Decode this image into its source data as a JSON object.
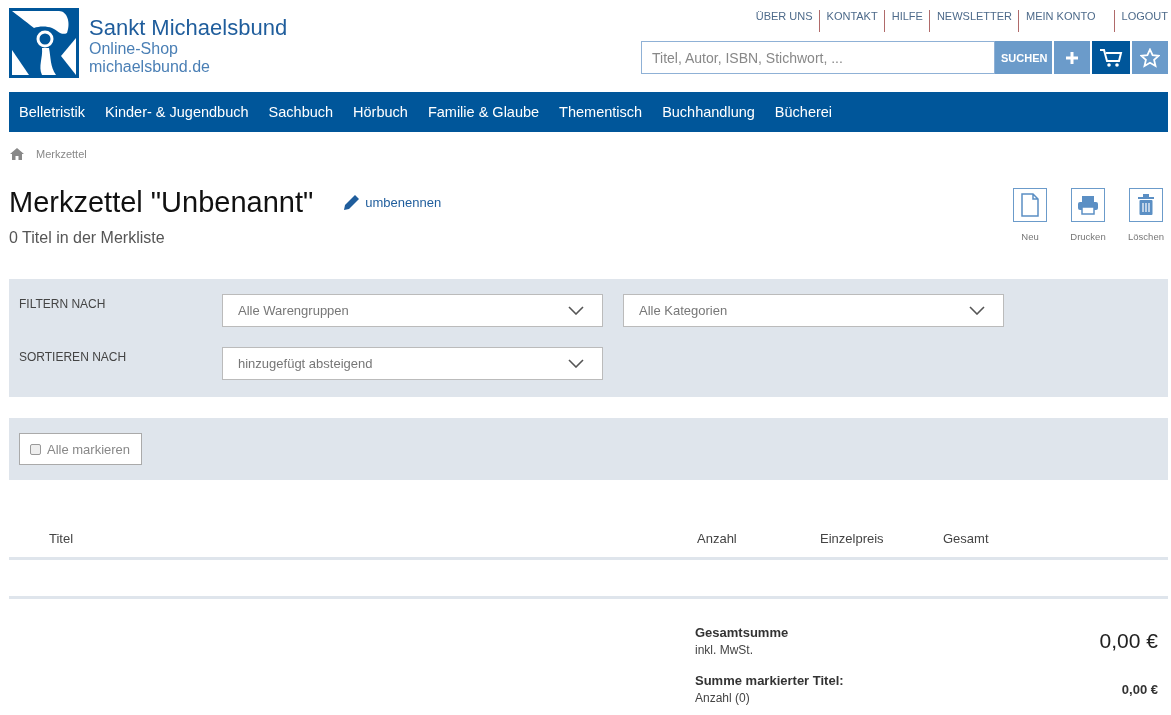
{
  "brand": {
    "name": "Sankt Michaelsbund",
    "line2": "Online-Shop",
    "line3": "michaelsbund.de"
  },
  "top_links": [
    "ÜBER UNS",
    "KONTAKT",
    "HILFE",
    "NEWSLETTER",
    "MEIN KONTO",
    "LOGOUT"
  ],
  "search": {
    "placeholder": "Titel, Autor, ISBN, Stichwort, ...",
    "button": "SUCHEN"
  },
  "nav": [
    "Belletristik",
    "Kinder- & Jugendbuch",
    "Sachbuch",
    "Hörbuch",
    "Familie & Glaube",
    "Thementisch",
    "Buchhandlung",
    "Bücherei"
  ],
  "breadcrumb": "Merkzettel",
  "title": "Merkzettel \"Unbenannt\"",
  "rename": "umbenennen",
  "subtitle": "0 Titel in der Merkliste",
  "actions": [
    {
      "kind": "new",
      "label": "Neu"
    },
    {
      "kind": "print",
      "label": "Drucken"
    },
    {
      "kind": "delete",
      "label": "Löschen"
    }
  ],
  "filter": {
    "filter_label": "FILTERN NACH",
    "sort_label": "SORTIEREN NACH",
    "group": "Alle Warengruppen",
    "category": "Alle Kategorien",
    "sort": "hinzugefügt absteigend"
  },
  "select_all": {
    "label": "Alle markieren",
    "checked": false
  },
  "columns": [
    "Titel",
    "Anzahl",
    "Einzelpreis",
    "Gesamt"
  ],
  "totals": {
    "total_label": "Gesamtsumme",
    "total_note": "inkl. MwSt.",
    "total_value": "0,00 €",
    "marked_label": "Summe markierter Titel:",
    "marked_note": "Anzahl (0)",
    "marked_value": "0,00 €"
  }
}
